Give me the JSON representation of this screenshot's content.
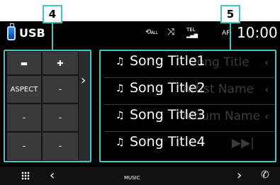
{
  "status": {
    "source": "USB",
    "repeat_label": "ALL",
    "tel_label": "TEL",
    "af_label": "AF",
    "clock": "10:00"
  },
  "panel": {
    "aspect_label": "ASPECT",
    "dash": "-"
  },
  "songs": [
    {
      "title": "Song Title1",
      "ghost": "Song Title"
    },
    {
      "title": "Song Title2",
      "ghost": "Artist Name"
    },
    {
      "title": "Song Title3",
      "ghost": "Album Name"
    },
    {
      "title": "Song Title4",
      "ghost": ""
    }
  ],
  "bottombar": {
    "label": "MUSIC"
  },
  "callouts": {
    "left": "4",
    "right": "5"
  },
  "colors": {
    "callout": "#3fc7c1",
    "background": "#000000"
  }
}
